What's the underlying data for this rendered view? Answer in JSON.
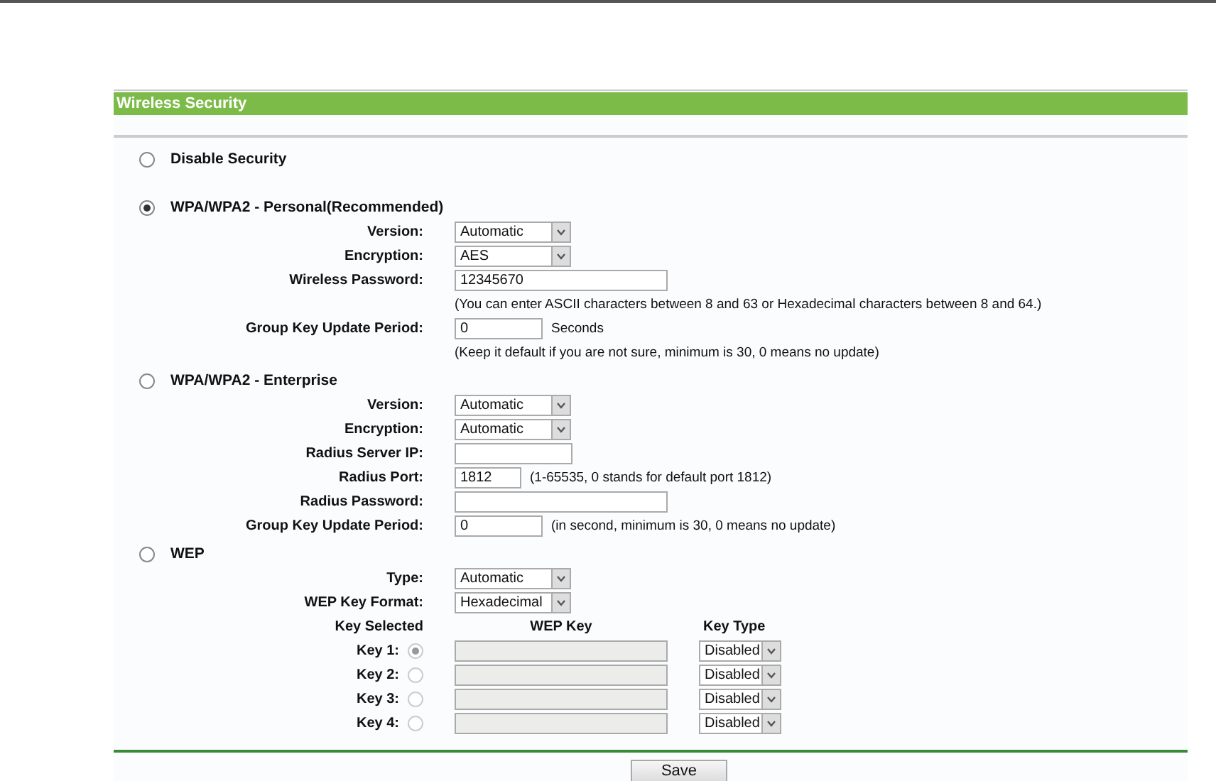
{
  "panel": {
    "title": "Wireless Security"
  },
  "sections": [
    {
      "label": "Disable Security",
      "selected": false
    },
    {
      "label": "WPA/WPA2 - Personal(Recommended)",
      "selected": true,
      "rows": [
        {
          "kind": "select",
          "label": "Version:",
          "value": "Automatic"
        },
        {
          "kind": "select",
          "label": "Encryption:",
          "value": "AES"
        },
        {
          "kind": "wide_field",
          "label": "Wireless Password:",
          "value": "12345670"
        },
        {
          "kind": "note",
          "text": "(You can enter ASCII characters between 8 and 63 or Hexadecimal characters between 8 and 64.)"
        },
        {
          "kind": "short_field",
          "label": "Group Key Update Period:",
          "value": "0",
          "suffix": "Seconds"
        },
        {
          "kind": "note",
          "text": "(Keep it default if you are not sure, minimum is 30, 0 means no update)"
        }
      ]
    },
    {
      "label": "WPA/WPA2 - Enterprise",
      "selected": false,
      "rows": [
        {
          "kind": "select",
          "label": "Version:",
          "value": "Automatic"
        },
        {
          "kind": "select",
          "label": "Encryption:",
          "value": "Automatic"
        },
        {
          "kind": "medium_field",
          "label": "Radius Server IP:"
        },
        {
          "kind": "tiny_field",
          "label": "Radius Port:",
          "value": "1812",
          "suffix": "(1-65535, 0 stands for default port 1812)"
        },
        {
          "kind": "wide_field",
          "label": "Radius Password:"
        },
        {
          "kind": "short_field",
          "label": "Group Key Update Period:",
          "value": "0",
          "suffix": "(in second, minimum is 30, 0 means no update)"
        }
      ]
    },
    {
      "label": "WEP",
      "selected": false,
      "rows": [
        {
          "kind": "select",
          "label": "Type:",
          "value": "Automatic"
        },
        {
          "kind": "select",
          "label": "WEP Key Format:",
          "value": "Hexadecimal"
        },
        {
          "kind": "keys",
          "headers": [
            "Key Selected",
            "WEP Key",
            "Key Type"
          ],
          "keys": [
            {
              "label": "Key 1:",
              "selected": true,
              "type": "Disabled"
            },
            {
              "label": "Key 2:",
              "selected": false,
              "type": "Disabled"
            },
            {
              "label": "Key 3:",
              "selected": false,
              "type": "Disabled"
            },
            {
              "label": "Key 4:",
              "selected": false,
              "type": "Disabled"
            }
          ]
        }
      ]
    }
  ],
  "save_button": "Save"
}
